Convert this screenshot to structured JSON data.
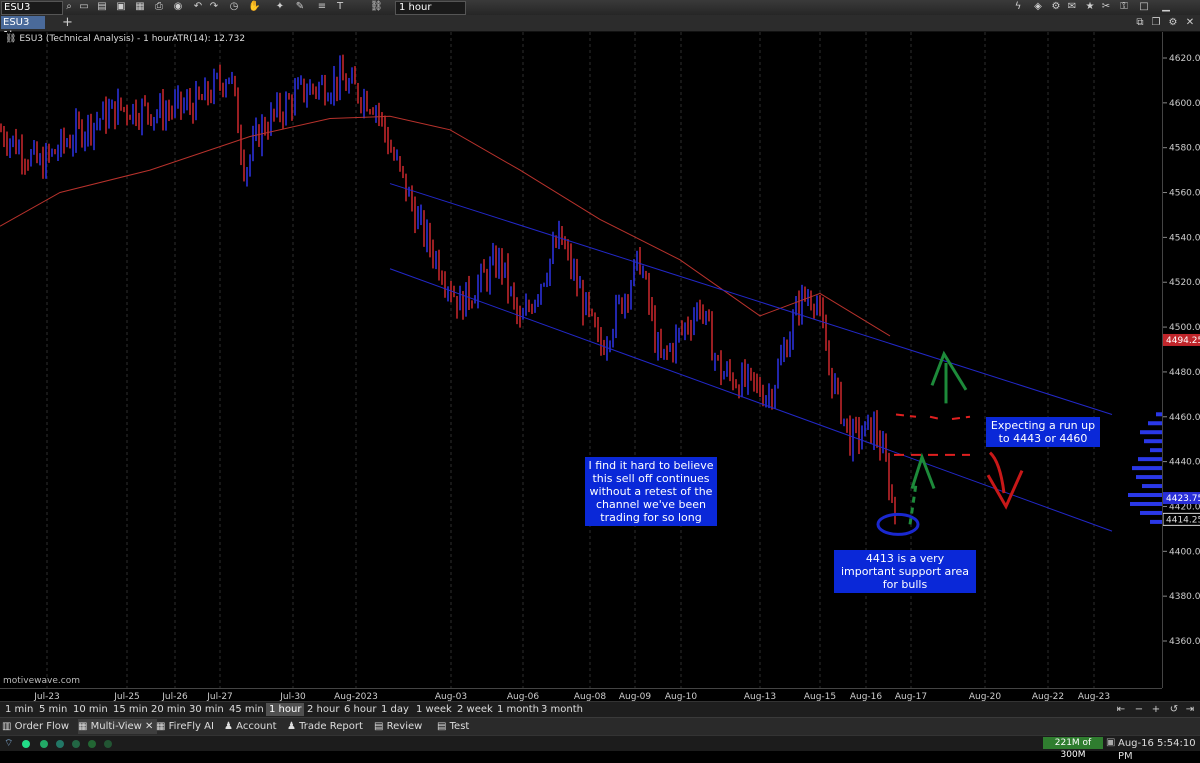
{
  "toolbar": {
    "symbol": "ESU3",
    "interval": "1 hour",
    "icons": [
      "search-icon",
      "new-icon",
      "open-folder-icon",
      "save-icon",
      "save-as-icon",
      "print-icon",
      "camera-icon",
      "undo-icon",
      "redo-icon",
      "history-icon",
      "hand-icon",
      "crosshair-icon",
      "pencil-icon",
      "fib-icon",
      "text-icon",
      "link-icon"
    ],
    "right_icons": [
      "flash-icon",
      "layers-icon",
      "gear-icon",
      "mail-icon",
      "star-icon",
      "tools-icon",
      "lock-icon",
      "maximize-icon",
      "minimize-icon"
    ]
  },
  "tabs": {
    "active": "ESU3 1h",
    "add": "+"
  },
  "chart": {
    "title": "ESU3 (Technical Analysis) - 1 hour",
    "indicator": "ATR(14): 12.732",
    "watermark": "motivewave.com",
    "colors": {
      "up": "#2a2fd8",
      "down": "#c0262b",
      "ma": "#b8322c",
      "channel": "#2228c8",
      "annotation_bg": "#0a28d8"
    },
    "price_ticks": [
      "4620.00",
      "4600.00",
      "4580.00",
      "4560.00",
      "4540.00",
      "4520.00",
      "4500.00",
      "4480.00",
      "4460.00",
      "4440.00",
      "4420.00",
      "4400.00",
      "4380.00",
      "4360.00"
    ],
    "price_markers": [
      {
        "label": "4494.25",
        "color": "#c0262b"
      },
      {
        "label": "4423.75",
        "color": "#2a2fd8"
      },
      {
        "label": "4414.25",
        "color": "#dddddd"
      }
    ],
    "date_ticks": [
      "Jul-23",
      "Jul-25",
      "Jul-26",
      "Jul-27",
      "Jul-30",
      "Aug-2023",
      "Aug-03",
      "Aug-06",
      "Aug-08",
      "Aug-09",
      "Aug-10",
      "Aug-13",
      "Aug-15",
      "Aug-16",
      "Aug-17",
      "Aug-20",
      "Aug-22",
      "Aug-23"
    ],
    "annotations": [
      "I find it hard to believe this sell off continues without a retest of the channel we've been trading for so long",
      "Expecting a run up to 4443 or 4460",
      "4413 is a very important support area for bulls"
    ]
  },
  "intervals": [
    "1 min",
    "5 min",
    "10 min",
    "15 min",
    "20 min",
    "30 min",
    "45 min",
    "1 hour",
    "2 hour",
    "6 hour",
    "1 day",
    "1 week",
    "2 week",
    "1 month",
    "3 month"
  ],
  "selected_interval": "1 hour",
  "bottom_tabs": [
    "Order Flow",
    "Multi-View",
    "FireFly AI",
    "Account",
    "Trade Report",
    "Review",
    "Test"
  ],
  "active_bottom_tab": "Multi-View",
  "status": {
    "memory": "221M of 300M",
    "datetime": "Aug-16 5:54:10 PM"
  }
}
